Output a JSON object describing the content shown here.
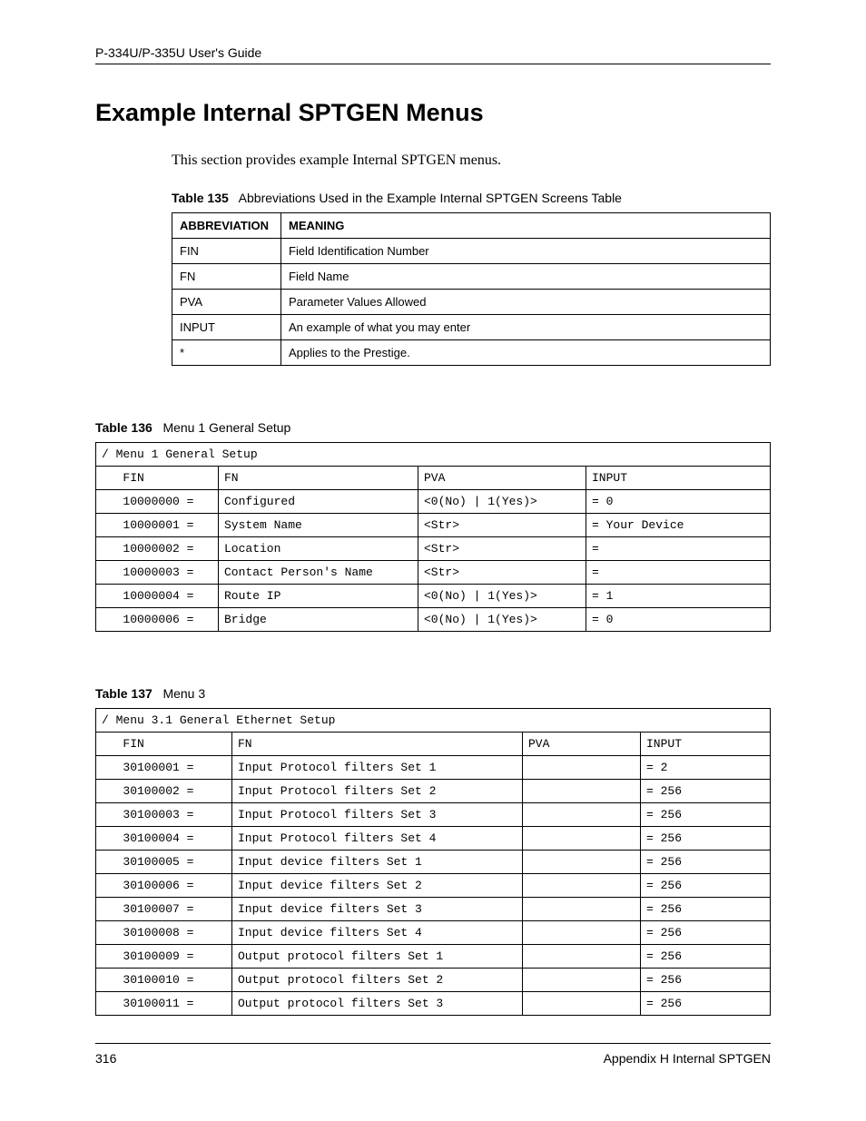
{
  "header": {
    "guide_title": "P-334U/P-335U User's Guide"
  },
  "heading": "Example Internal SPTGEN Menus",
  "intro": "This section provides example Internal SPTGEN menus.",
  "table135": {
    "caption_bold": "Table 135",
    "caption_rest": "   Abbreviations Used in the Example Internal SPTGEN Screens Table",
    "col1": "ABBREVIATION",
    "col2": "MEANING",
    "rows": [
      {
        "abbr": "FIN",
        "meaning": "Field Identification Number"
      },
      {
        "abbr": "FN",
        "meaning": "Field Name"
      },
      {
        "abbr": "PVA",
        "meaning": "Parameter Values Allowed"
      },
      {
        "abbr": "INPUT",
        "meaning": "An example of what you may enter"
      },
      {
        "abbr": "*",
        "meaning": "Applies to the Prestige."
      }
    ]
  },
  "table136": {
    "caption_bold": "Table 136",
    "caption_rest": "   Menu 1 General Setup",
    "title": "/ Menu 1 General Setup",
    "headers": {
      "fin": "   FIN",
      "fn": "FN",
      "pva": "PVA",
      "input": "INPUT"
    },
    "rows": [
      {
        "fin": "   10000000 =",
        "fn": "Configured",
        "pva": "<0(No) | 1(Yes)>",
        "input": "= 0"
      },
      {
        "fin": "   10000001 =",
        "fn": "System Name",
        "pva": "<Str>",
        "input": "= Your Device"
      },
      {
        "fin": "   10000002 =",
        "fn": "Location",
        "pva": "<Str>",
        "input": "="
      },
      {
        "fin": "   10000003 =",
        "fn": "Contact Person's Name",
        "pva": "<Str>",
        "input": "="
      },
      {
        "fin": "   10000004 =",
        "fn": "Route IP",
        "pva": "<0(No) | 1(Yes)>",
        "input": "= 1"
      },
      {
        "fin": "   10000006 =",
        "fn": "Bridge",
        "pva": "<0(No) | 1(Yes)>",
        "input": "= 0"
      }
    ]
  },
  "table137": {
    "caption_bold": "Table 137",
    "caption_rest": "   Menu 3",
    "title": "/ Menu 3.1 General Ethernet Setup",
    "headers": {
      "fin": "   FIN",
      "fn": "FN",
      "pva": "PVA",
      "input": "INPUT"
    },
    "rows": [
      {
        "fin": "   30100001 =",
        "fn": "Input Protocol filters Set 1",
        "pva": "",
        "input": "= 2"
      },
      {
        "fin": "   30100002 =",
        "fn": "Input Protocol filters Set 2",
        "pva": "",
        "input": "= 256"
      },
      {
        "fin": "   30100003 =",
        "fn": "Input Protocol filters Set 3",
        "pva": "",
        "input": "= 256"
      },
      {
        "fin": "   30100004 =",
        "fn": "Input Protocol filters Set 4",
        "pva": "",
        "input": "= 256"
      },
      {
        "fin": "   30100005 =",
        "fn": "Input device filters Set 1",
        "pva": "",
        "input": "= 256"
      },
      {
        "fin": "   30100006 =",
        "fn": "Input device filters Set 2",
        "pva": "",
        "input": "= 256"
      },
      {
        "fin": "   30100007 =",
        "fn": "Input device filters Set 3",
        "pva": "",
        "input": "= 256"
      },
      {
        "fin": "   30100008 =",
        "fn": "Input device filters Set 4",
        "pva": "",
        "input": "= 256"
      },
      {
        "fin": "   30100009 =",
        "fn": "Output protocol filters Set 1",
        "pva": "",
        "input": "= 256"
      },
      {
        "fin": "   30100010 =",
        "fn": "Output protocol filters Set 2",
        "pva": "",
        "input": "= 256"
      },
      {
        "fin": "   30100011 =",
        "fn": "Output protocol filters Set 3",
        "pva": "",
        "input": "= 256"
      }
    ]
  },
  "footer": {
    "page_number": "316",
    "appendix": "Appendix H Internal SPTGEN"
  }
}
